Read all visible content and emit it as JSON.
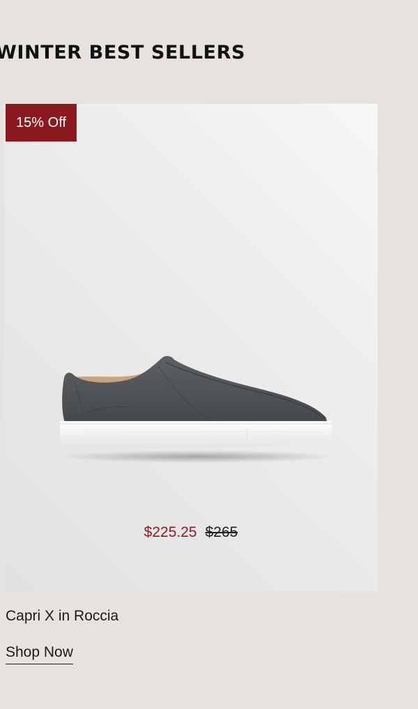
{
  "section": {
    "title": "WINTER BEST SELLERS"
  },
  "product": {
    "badge": "15% Off",
    "sale_price": "$225.25",
    "original_price": "$265",
    "name": "Capri X in Roccia",
    "cta": "Shop Now",
    "image_icon": "sneaker-image"
  },
  "colors": {
    "page_background": "#e6e2de",
    "badge_background": "#8a1a1d",
    "sale_price": "#8a1a1d",
    "shoe_upper": "#54575a",
    "shoe_sole": "#f6f6f6"
  }
}
